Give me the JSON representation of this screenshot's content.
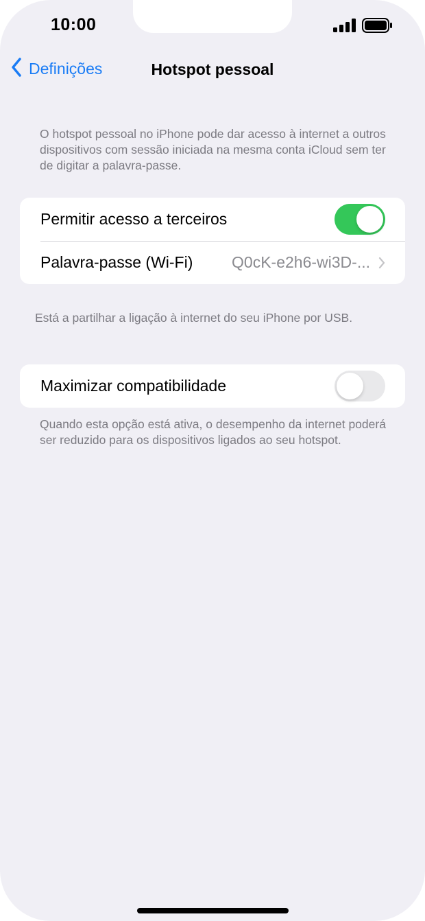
{
  "status_bar": {
    "time": "10:00",
    "signal_icon": "cellular-signal-icon",
    "battery_icon": "battery-icon"
  },
  "nav": {
    "back_label": "Definições",
    "back_icon": "chevron-left-icon",
    "title": "Hotspot pessoal"
  },
  "intro_text": "O hotspot pessoal no iPhone pode dar acesso à internet a outros dispositivos com sessão iniciada na mesma conta iCloud sem ter de digitar a palavra-passe.",
  "group1": {
    "allow_access": {
      "label": "Permitir acesso a terceiros",
      "enabled": true
    },
    "password": {
      "label": "Palavra-passe (Wi-Fi)",
      "value": "Q0cK-e2h6-wi3D-...",
      "icon": "chevron-right-icon"
    }
  },
  "usb_note": "Está a partilhar a ligação à internet do seu iPhone por USB.",
  "group2": {
    "maximize": {
      "label": "Maximizar compatibilidade",
      "enabled": false
    }
  },
  "maximize_note": "Quando esta opção está ativa, o desempenho da internet poderá ser reduzido para os dispositivos ligados ao seu hotspot.",
  "colors": {
    "accent": "#1a7cf5",
    "toggle_on": "#34c759",
    "toggle_off": "#e9e9eb",
    "background": "#f0eff5",
    "secondary_text": "#7c7b82"
  }
}
